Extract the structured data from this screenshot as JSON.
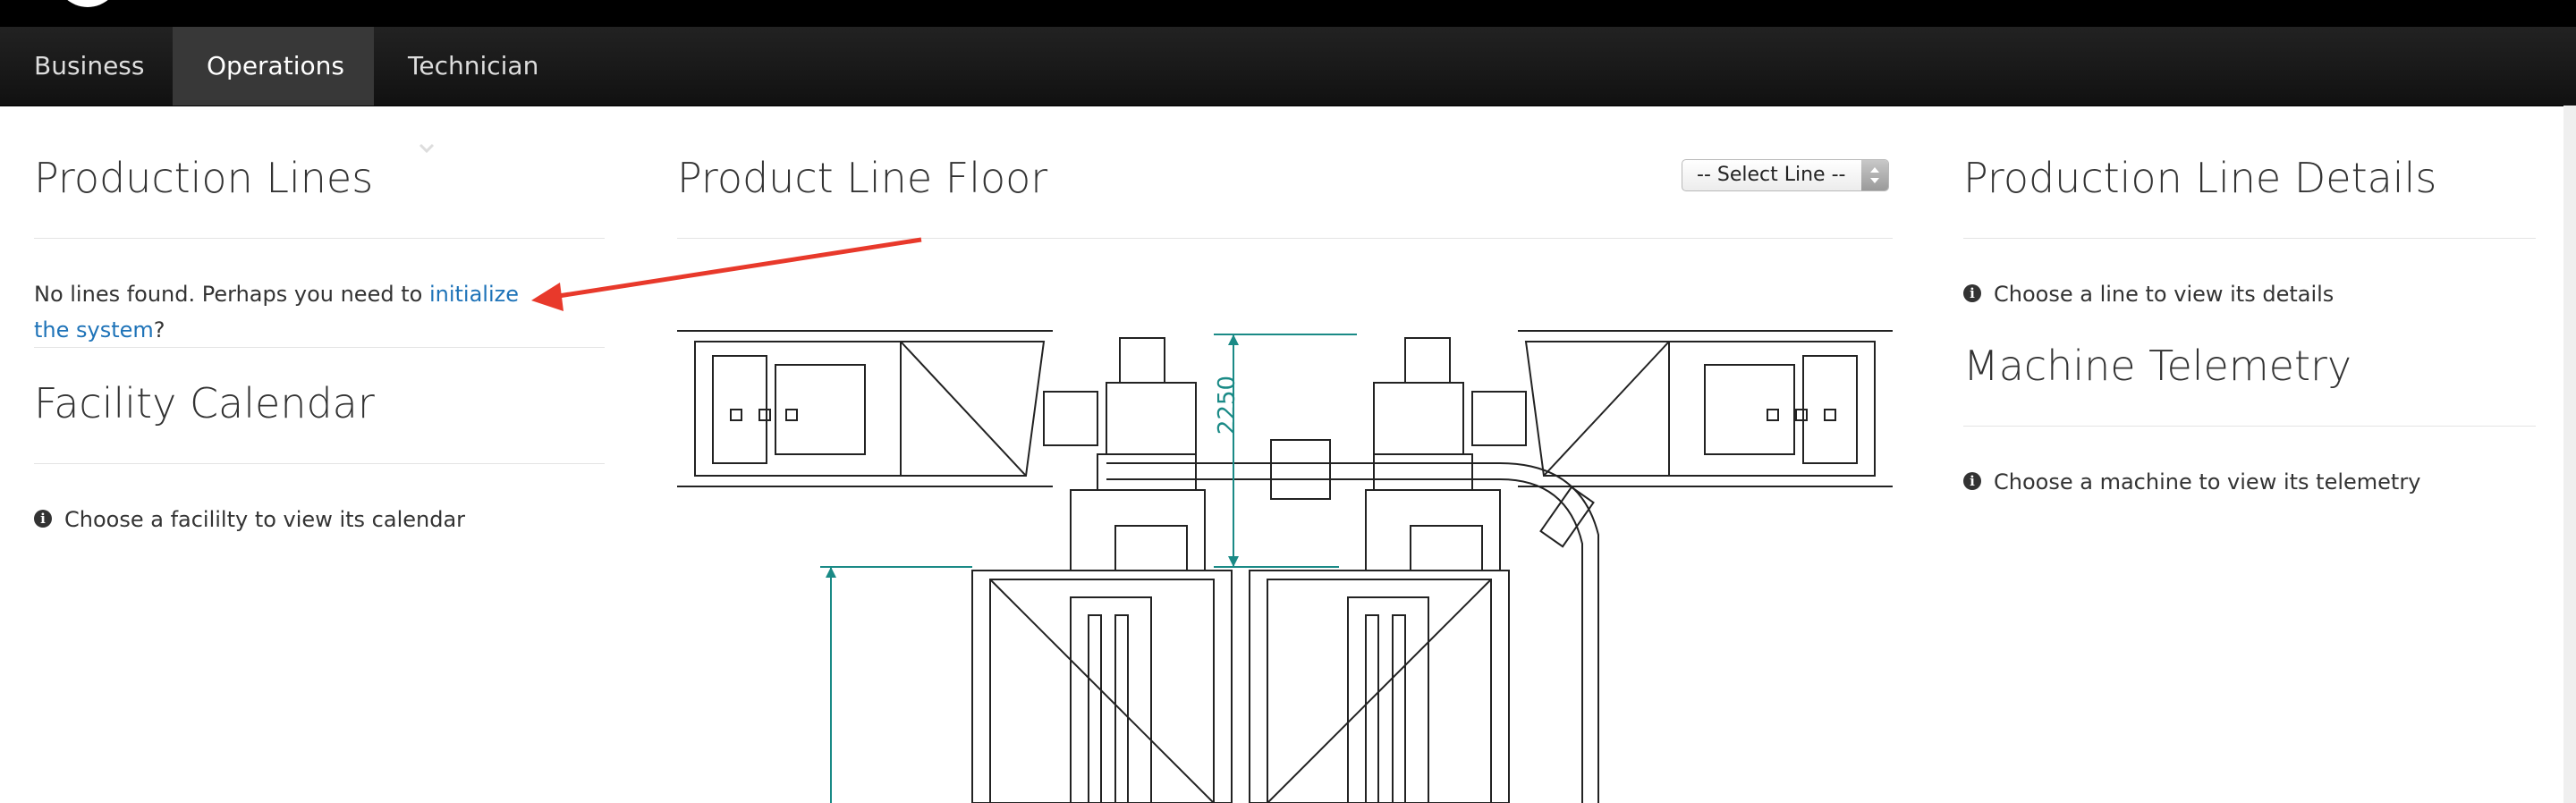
{
  "nav": {
    "items": [
      {
        "label": "Business"
      },
      {
        "label": "Operations"
      },
      {
        "label": "Technician"
      }
    ]
  },
  "left": {
    "production_lines": {
      "title": "Production Lines",
      "message_prefix": "No lines found. Perhaps you need to ",
      "link_text": "initialize the system",
      "message_suffix": "?"
    },
    "facility_calendar": {
      "title": "Facility Calendar",
      "message": "Choose a facililty to view its calendar"
    }
  },
  "center": {
    "title": "Product Line Floor",
    "select": {
      "value": "-- Select Line --"
    },
    "drawing": {
      "dimension_label": "2250"
    }
  },
  "right": {
    "details": {
      "title": "Production Line Details",
      "message": "Choose a line to view its details"
    },
    "telemetry": {
      "title": "Machine Telemetry",
      "message": "Choose a machine to view its telemetry"
    }
  },
  "colors": {
    "link": "#1e73b8",
    "annotation_arrow": "#e8392b",
    "dimension_teal": "#1a8a86"
  },
  "icons": [
    "info-icon",
    "chevron-down-icon",
    "select-arrows-icon"
  ]
}
